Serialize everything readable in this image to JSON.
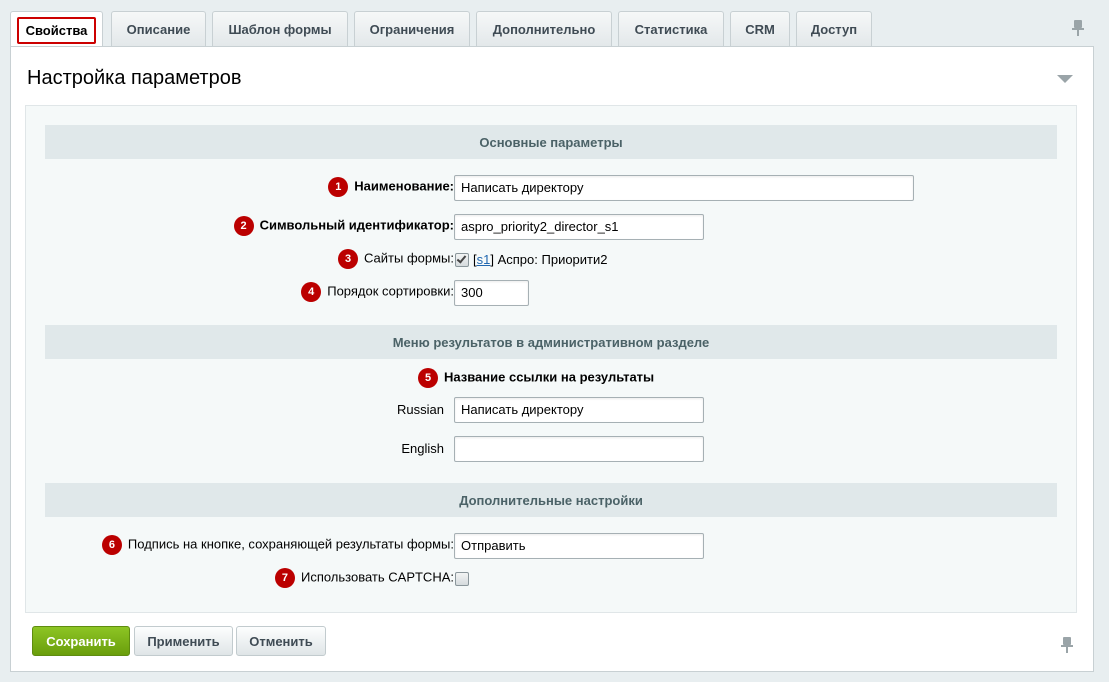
{
  "tabs": [
    {
      "label": "Свойства",
      "active": true
    },
    {
      "label": "Описание"
    },
    {
      "label": "Шаблон формы"
    },
    {
      "label": "Ограничения"
    },
    {
      "label": "Дополнительно"
    },
    {
      "label": "Статистика"
    },
    {
      "label": "CRM"
    },
    {
      "label": "Доступ"
    }
  ],
  "panel": {
    "title": "Настройка параметров"
  },
  "sections": {
    "main": "Основные параметры",
    "menu": "Меню результатов в административном разделе",
    "extra": "Дополнительные настройки"
  },
  "fields": {
    "name": {
      "badge": "1",
      "label": "Наименование:",
      "value": "Написать директору"
    },
    "code": {
      "badge": "2",
      "label": "Символьный идентификатор:",
      "value": "aspro_priority2_director_s1"
    },
    "sites": {
      "badge": "3",
      "label": "Сайты формы:",
      "checked": true,
      "bracket_open": "[",
      "site_link": "s1",
      "bracket_close": "]",
      "site_name": " Аспро: Приорити2"
    },
    "sort": {
      "badge": "4",
      "label": "Порядок сортировки:",
      "value": "300"
    },
    "results_link": {
      "badge": "5",
      "label": "Название ссылки на результаты"
    },
    "russian": {
      "label": "Russian",
      "value": "Написать директору"
    },
    "english": {
      "label": "English",
      "value": ""
    },
    "button_caption": {
      "badge": "6",
      "label": "Подпись на кнопке, сохраняющей результаты формы:",
      "value": "Отправить"
    },
    "captcha": {
      "badge": "7",
      "label": "Использовать CAPTCHA:",
      "checked": false
    }
  },
  "buttons": {
    "save": "Сохранить",
    "apply": "Применить",
    "cancel": "Отменить"
  },
  "colors": {
    "badge": "#bb0000",
    "save_button": "#78b018",
    "active_tab_outline": "#cc0000"
  }
}
